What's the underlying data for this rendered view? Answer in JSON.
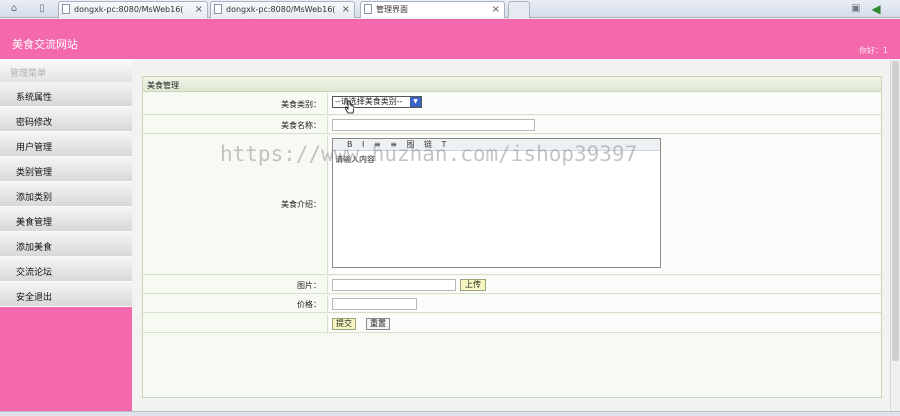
{
  "browser": {
    "tabs": [
      {
        "label": "dongxk-pc:8080/MsWeb16("
      },
      {
        "label": "dongxk-pc:8080/MsWeb16("
      },
      {
        "label": "管理界面"
      }
    ]
  },
  "header": {
    "site_title": "美食交流网站",
    "welcome": "你好：1"
  },
  "sidebar": {
    "section_title": "管理菜单",
    "items": [
      {
        "label": "系统属性"
      },
      {
        "label": "密码修改"
      },
      {
        "label": "用户管理"
      },
      {
        "label": "类别管理"
      },
      {
        "label": "添加类别"
      },
      {
        "label": "美食管理"
      },
      {
        "label": "添加美食"
      },
      {
        "label": "交流论坛"
      },
      {
        "label": "安全退出"
      }
    ]
  },
  "form": {
    "panel_title": "美食管理",
    "category_label": "美食类别：",
    "category_selected": "--请选择美食类别--",
    "name_label": "美食名称：",
    "name_value": "",
    "intro_label": "美食介绍：",
    "editor_toolbar": [
      "B",
      "I",
      "≡",
      "≡",
      "图",
      "链",
      "T"
    ],
    "editor_placeholder": "请输入内容",
    "image_label": "图片：",
    "image_value": "",
    "upload_label": "上传",
    "price_label": "价格：",
    "price_value": "",
    "submit_label": "提交",
    "reset_label": "重置"
  },
  "watermark": "https://www.huzhan.com/ishop39397"
}
